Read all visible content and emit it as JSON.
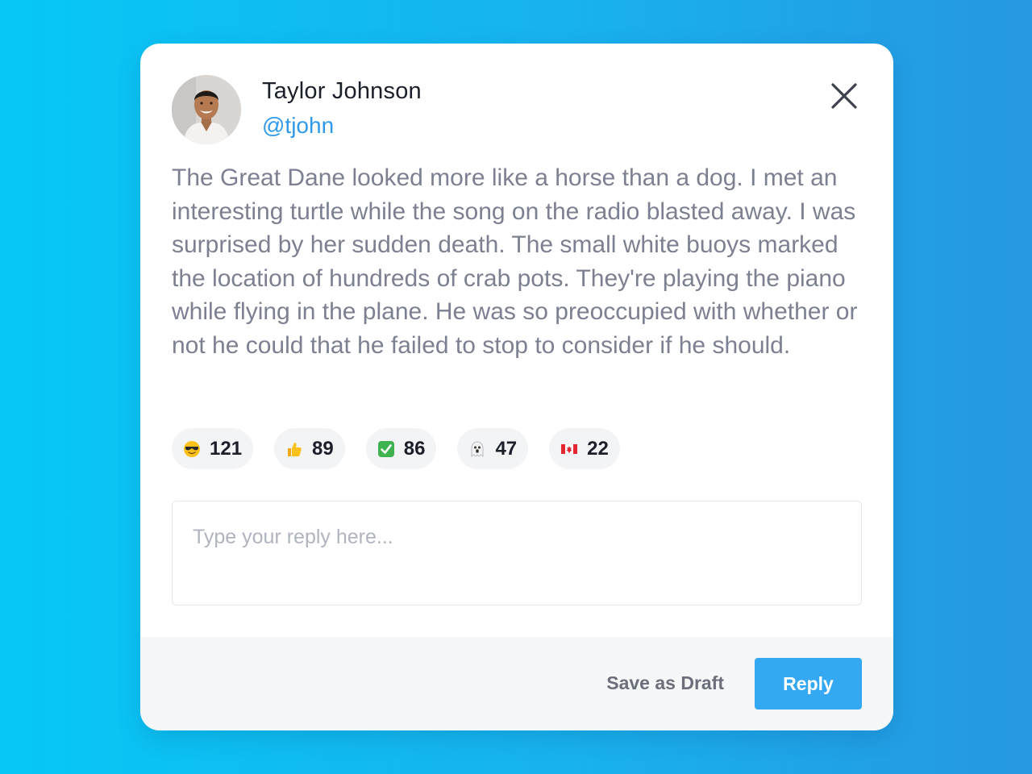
{
  "post": {
    "author_name": "Taylor Johnson",
    "author_handle": "@tjohn",
    "message": "The Great Dane looked more like a horse than a dog. I met an interesting turtle while the song on the radio blasted away. I was surprised by her sudden death. The small white buoys marked the location of hundreds of crab pots. They're playing the piano while flying in the plane. He was so preoccupied with whether or not he could that he failed to stop to consider if he should."
  },
  "reactions": [
    {
      "icon": "sunglasses-face-icon",
      "count": "121"
    },
    {
      "icon": "thumbs-up-icon",
      "count": "89"
    },
    {
      "icon": "check-mark-button-icon",
      "count": "86"
    },
    {
      "icon": "ghost-icon",
      "count": "47"
    },
    {
      "icon": "canada-flag-icon",
      "count": "22"
    }
  ],
  "reply": {
    "placeholder": "Type your reply here...",
    "value": ""
  },
  "footer": {
    "draft_label": "Save as Draft",
    "reply_label": "Reply"
  },
  "colors": {
    "accent": "#35a8f3",
    "handle": "#2f9ae9",
    "background_start": "#06c8f6",
    "background_end": "#2697e2"
  }
}
